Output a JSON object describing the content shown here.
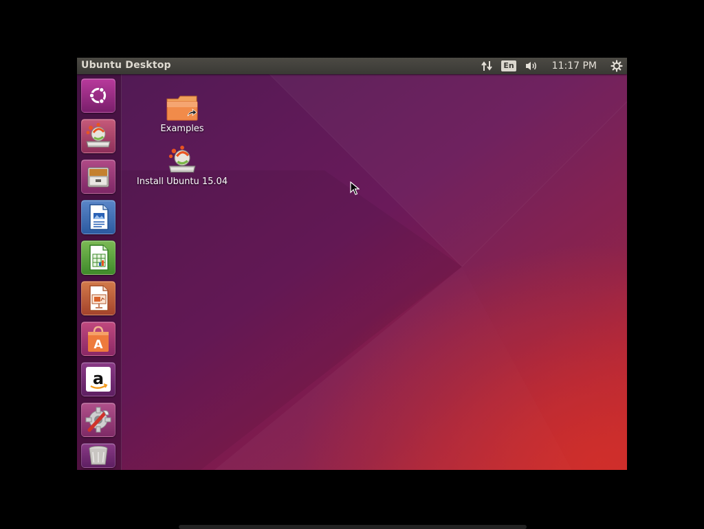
{
  "top_panel": {
    "title": "Ubuntu Desktop",
    "keyboard_layout": "En",
    "clock": "11:17 PM"
  },
  "launcher": {
    "items": [
      {
        "name": "dash-home",
        "icon": "ubuntu-logo-icon"
      },
      {
        "name": "install-ubuntu",
        "icon": "installer-icon"
      },
      {
        "name": "files",
        "icon": "file-cabinet-icon"
      },
      {
        "name": "libreoffice-writer",
        "icon": "writer-icon"
      },
      {
        "name": "libreoffice-calc",
        "icon": "calc-icon"
      },
      {
        "name": "libreoffice-impress",
        "icon": "impress-icon"
      },
      {
        "name": "ubuntu-software-center",
        "icon": "shopping-bag-icon"
      },
      {
        "name": "amazon",
        "icon": "amazon-icon"
      },
      {
        "name": "system-settings",
        "icon": "settings-gear-icon"
      },
      {
        "name": "trash",
        "icon": "trash-icon"
      }
    ]
  },
  "desktop": {
    "icons": [
      {
        "label": "Examples",
        "icon": "folder-link-icon"
      },
      {
        "label": "Install Ubuntu 15.04",
        "icon": "installer-icon"
      }
    ]
  },
  "colors": {
    "panel": "#3a3935",
    "wallpaper_top": "#5a1d5c",
    "wallpaper_bottom_right": "#b4202c",
    "ubuntu_orange": "#e95420"
  }
}
